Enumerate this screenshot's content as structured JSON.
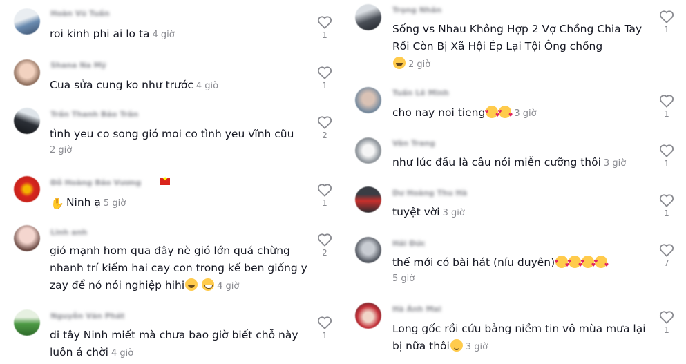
{
  "left_comments": [
    {
      "username": "Hoàn Vũ Tuấn",
      "text": "roi kinh phi ai lo ta",
      "time": "4 giờ",
      "likes": "1"
    },
    {
      "username": "Shana Na Mỹ",
      "text": "Cua sửa cung ko như trước",
      "time": "4 giờ",
      "likes": "1"
    },
    {
      "username": "Trần Thanh Bảo Trân",
      "text": "tình yeu co song gió moi co tình yeu vĩnh cũu",
      "time": "2 giờ",
      "likes": "2"
    },
    {
      "username": "Đỗ Hoàng Bảo Vương",
      "text": "Ninh ạ",
      "time": "5 giờ",
      "likes": "1"
    },
    {
      "username": "Linh anh",
      "text": "gió mạnh hom qua đây nè gió lớn quá chừng nhanh trí kiếm hai cay con trong kế ben giống y zay để nó nói nghiệp hihi",
      "time": "4 giờ",
      "likes": "2"
    },
    {
      "username": "Nguyễn Văn Phát",
      "text": "di tây Ninh miết mà chưa bao giờ biết chỗ này luôn á chời",
      "time": "4 giờ",
      "likes": "1"
    }
  ],
  "right_comments": [
    {
      "username": "Trọng Nhân",
      "text": "Sống vs Nhau Không Hợp 2 Vợ Chồng Chia Tay Rồi Còn Bị Xã Hội Ép Lại Tội Ông chồng",
      "time": "2 giờ",
      "likes": "1"
    },
    {
      "username": "Tuấn Lê Minh",
      "text": "cho nay noi tieng",
      "time": "3 giờ",
      "likes": "1"
    },
    {
      "username": "Vân Trang",
      "text": "như lúc đầu là câu nói miễn cưỡng thôi",
      "time": "3 giờ",
      "likes": "1"
    },
    {
      "username": "Dư Hoàng Thu Hà",
      "text": "tuyệt vời",
      "time": "3 giờ",
      "likes": "1"
    },
    {
      "username": "Hải Đức",
      "text": "thế mới có bài hát (níu duyên)",
      "time": "5 giờ",
      "likes": "7"
    },
    {
      "username": "Hà Ánh Mai",
      "text": "Long gốc rồi cứu bằng niềm tin vô mùa mưa lại bị nữa thôi",
      "time": "3 giờ",
      "likes": "1"
    }
  ],
  "icons": {
    "like": "heart-outline-icon",
    "hand": "raised-hand-emoji",
    "laugh": "tears-of-joy-emoji",
    "grin": "grinning-emoji",
    "love": "smiling-with-hearts-emoji",
    "relieved": "relieved-emoji",
    "flag": "vietnam-flag-emoji"
  },
  "colors": {
    "text": "#161823",
    "muted": "#8a8b91",
    "heart_outline": "#8a8b91"
  }
}
